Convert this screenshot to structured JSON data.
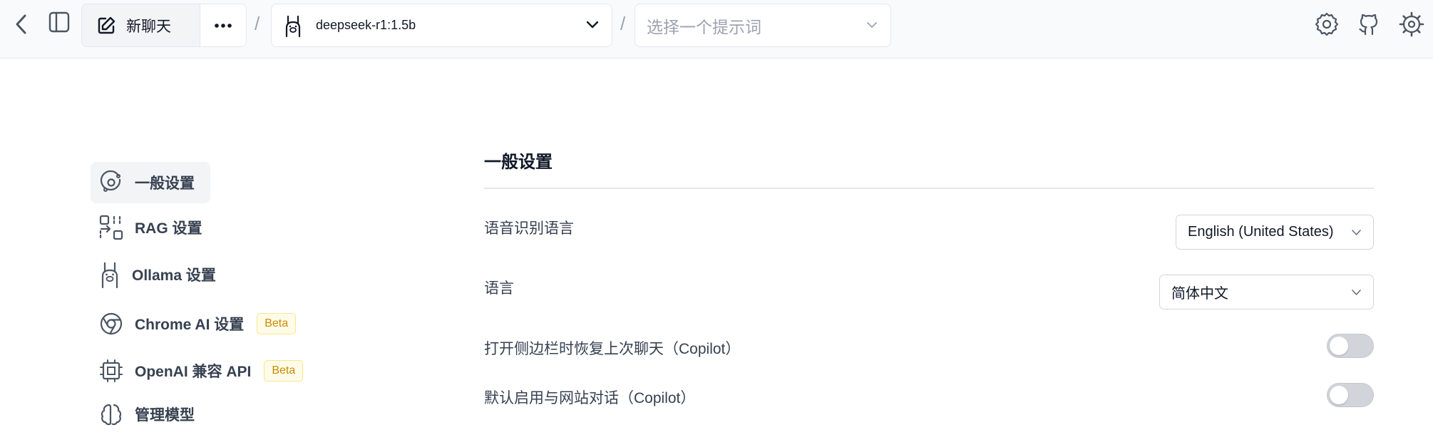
{
  "header": {
    "new_chat_label": "新聊天",
    "separator": "/",
    "model": "deepseek-r1:1.5b",
    "prompt_placeholder": "选择一个提示词"
  },
  "sidebar": {
    "items": [
      {
        "label": "一般设置",
        "icon": "general-settings-icon",
        "active": true
      },
      {
        "label": "RAG 设置",
        "icon": "rag-icon"
      },
      {
        "label": "Ollama 设置",
        "icon": "llama-icon"
      },
      {
        "label": "Chrome AI 设置",
        "icon": "chrome-icon",
        "badge": "Beta"
      },
      {
        "label": "OpenAI 兼容 API",
        "icon": "chip-icon",
        "badge": "Beta"
      },
      {
        "label": "管理模型",
        "icon": "brain-icon"
      }
    ]
  },
  "main": {
    "title": "一般设置",
    "settings": [
      {
        "label": "语音识别语言",
        "type": "select",
        "value": "English (United States)"
      },
      {
        "label": "语言",
        "type": "select",
        "value": "简体中文"
      },
      {
        "label": "打开侧边栏时恢复上次聊天（Copilot）",
        "type": "toggle",
        "on": false
      },
      {
        "label": "默认启用与网站对话（Copilot）",
        "type": "toggle",
        "on": false
      }
    ]
  },
  "colors": {
    "accent_badge_text": "#ca8a04",
    "toggle_off": "#d1d5db"
  }
}
